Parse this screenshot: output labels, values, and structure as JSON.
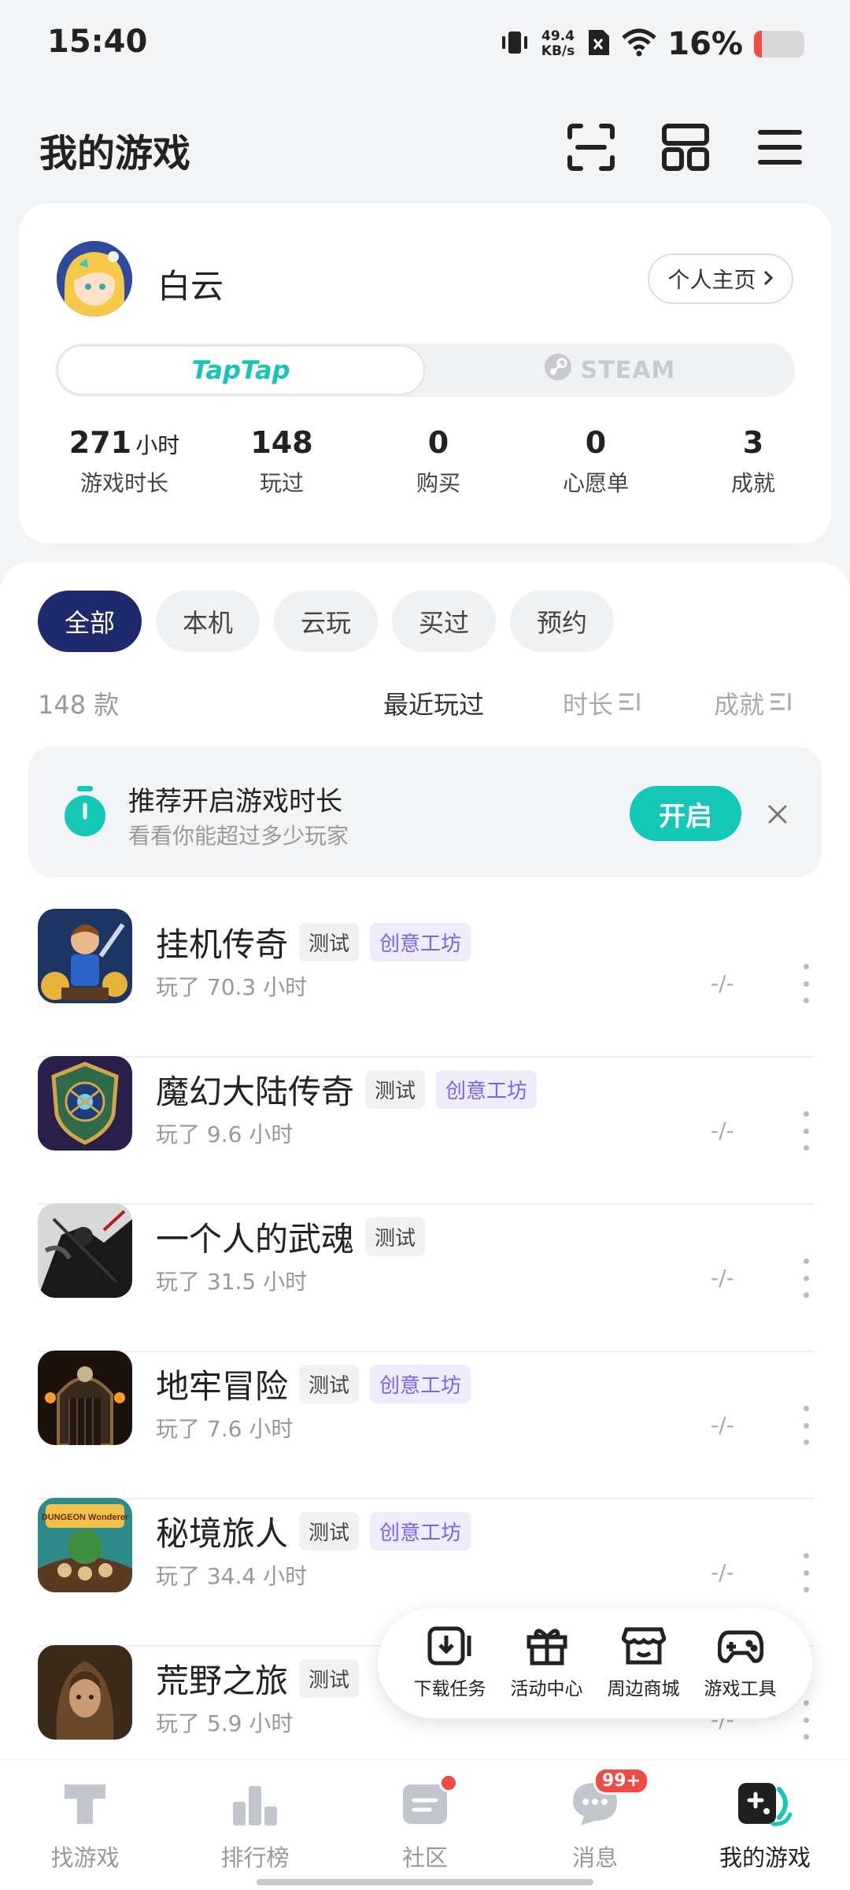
{
  "status_bar": {
    "time": "15:40",
    "net_speed_value": "49.4",
    "net_speed_unit": "KB/s",
    "battery": "16%",
    "battery_level": 0.16,
    "icons": [
      "vibrate-icon",
      "sim-off-icon",
      "wifi-icon",
      "battery-icon"
    ]
  },
  "header": {
    "title": "我的游戏",
    "icons": [
      "scan-icon",
      "grid-layout-icon",
      "menu-icon"
    ]
  },
  "profile": {
    "name": "白云",
    "homepage_button": "个人主页",
    "platforms": [
      "TapTap",
      "STEAM"
    ],
    "active_platform": "TapTap",
    "stats": [
      {
        "value": "271",
        "unit": "小时",
        "label": "游戏时长"
      },
      {
        "value": "148",
        "unit": "",
        "label": "玩过"
      },
      {
        "value": "0",
        "unit": "",
        "label": "购买"
      },
      {
        "value": "0",
        "unit": "",
        "label": "心愿单"
      },
      {
        "value": "3",
        "unit": "",
        "label": "成就"
      }
    ]
  },
  "filters": {
    "chips": [
      "全部",
      "本机",
      "云玩",
      "买过",
      "预约"
    ],
    "active": "全部",
    "count": "148 款",
    "sorts": [
      "最近玩过",
      "时长",
      "成就"
    ],
    "active_sort": "最近玩过"
  },
  "promo": {
    "title": "推荐开启游戏时长",
    "subtitle": "看看你能超过多少玩家",
    "button": "开启",
    "accent": "#14c8b8"
  },
  "games": [
    {
      "name": "挂机传奇",
      "tags": [
        "测试",
        "创意工坊"
      ],
      "playtime": "玩了 70.3 小时",
      "score": "-/-"
    },
    {
      "name": "魔幻大陆传奇",
      "tags": [
        "测试",
        "创意工坊"
      ],
      "playtime": "玩了 9.6 小时",
      "score": "-/-"
    },
    {
      "name": "一个人的武魂",
      "tags": [
        "测试"
      ],
      "playtime": "玩了 31.5 小时",
      "score": "-/-"
    },
    {
      "name": "地牢冒险",
      "tags": [
        "测试",
        "创意工坊"
      ],
      "playtime": "玩了 7.6 小时",
      "score": "-/-"
    },
    {
      "name": "秘境旅人",
      "tags": [
        "测试",
        "创意工坊"
      ],
      "playtime": "玩了 34.4 小时",
      "score": "-/-"
    },
    {
      "name": "荒野之旅",
      "tags": [
        "测试"
      ],
      "playtime": "玩了 5.9 小时",
      "score": "-/-"
    }
  ],
  "game_thumb_logo_text": "DUNGEON Wonderer",
  "tools": [
    {
      "label": "下载任务",
      "icon": "download-icon"
    },
    {
      "label": "活动中心",
      "icon": "gift-icon"
    },
    {
      "label": "周边商城",
      "icon": "shop-icon"
    },
    {
      "label": "游戏工具",
      "icon": "gamepad-icon"
    }
  ],
  "bottom_nav": [
    {
      "label": "找游戏",
      "icon": "taptap-logo-icon"
    },
    {
      "label": "排行榜",
      "icon": "ranking-icon"
    },
    {
      "label": "社区",
      "icon": "community-icon"
    },
    {
      "label": "消息",
      "icon": "message-icon",
      "badge": "99+"
    },
    {
      "label": "我的游戏",
      "icon": "my-games-icon"
    }
  ],
  "active_nav": "我的游戏"
}
